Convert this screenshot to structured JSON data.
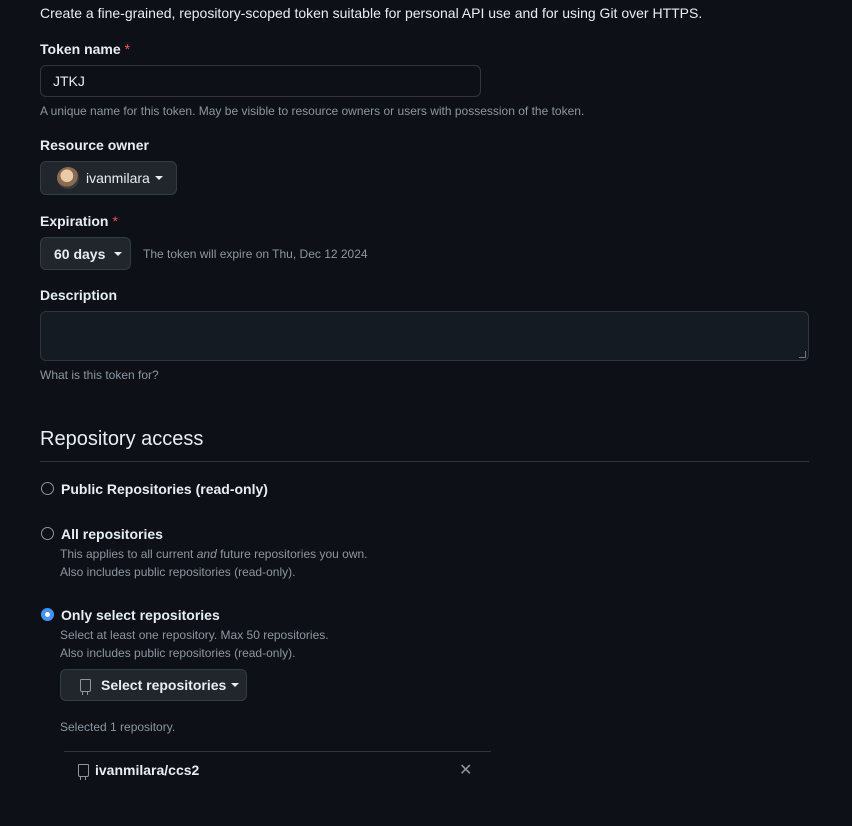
{
  "intro": "Create a fine-grained, repository-scoped token suitable for personal API use and for using Git over HTTPS.",
  "token_name": {
    "label": "Token name",
    "required_mark": "*",
    "value": "JTKJ",
    "hint": "A unique name for this token. May be visible to resource owners or users with possession of the token."
  },
  "resource_owner": {
    "label": "Resource owner",
    "selected": "ivanmilara"
  },
  "expiration": {
    "label": "Expiration",
    "required_mark": "*",
    "selected": "60 days",
    "note": "The token will expire on Thu, Dec 12 2024"
  },
  "description": {
    "label": "Description",
    "value": "",
    "hint": "What is this token for?"
  },
  "repository_access": {
    "title": "Repository access",
    "options": [
      {
        "label": "Public Repositories (read-only)",
        "checked": false
      },
      {
        "label": "All repositories",
        "checked": false,
        "desc_pre": "This applies to all current ",
        "desc_em": "and",
        "desc_post": " future repositories you own.",
        "desc2": "Also includes public repositories (read-only)."
      },
      {
        "label": "Only select repositories",
        "checked": true,
        "desc1": "Select at least one repository. Max 50 repositories.",
        "desc2": "Also includes public repositories (read-only)."
      }
    ],
    "select_button": "Select repositories",
    "selected_count": "Selected 1 repository.",
    "selected_repos": [
      "ivanmilara/ccs2"
    ],
    "remove_glyph": "✕"
  },
  "icons": {
    "repo": "repo-icon",
    "caret": "caret-down-icon",
    "close": "close-icon",
    "avatar": "user-avatar"
  },
  "colors": {
    "background": "#0d1117",
    "text": "#e6edf3",
    "muted": "#8d96a0",
    "required": "#f85149",
    "accent": "#4493f8",
    "button_bg": "#21262d",
    "border": "#30363d"
  }
}
